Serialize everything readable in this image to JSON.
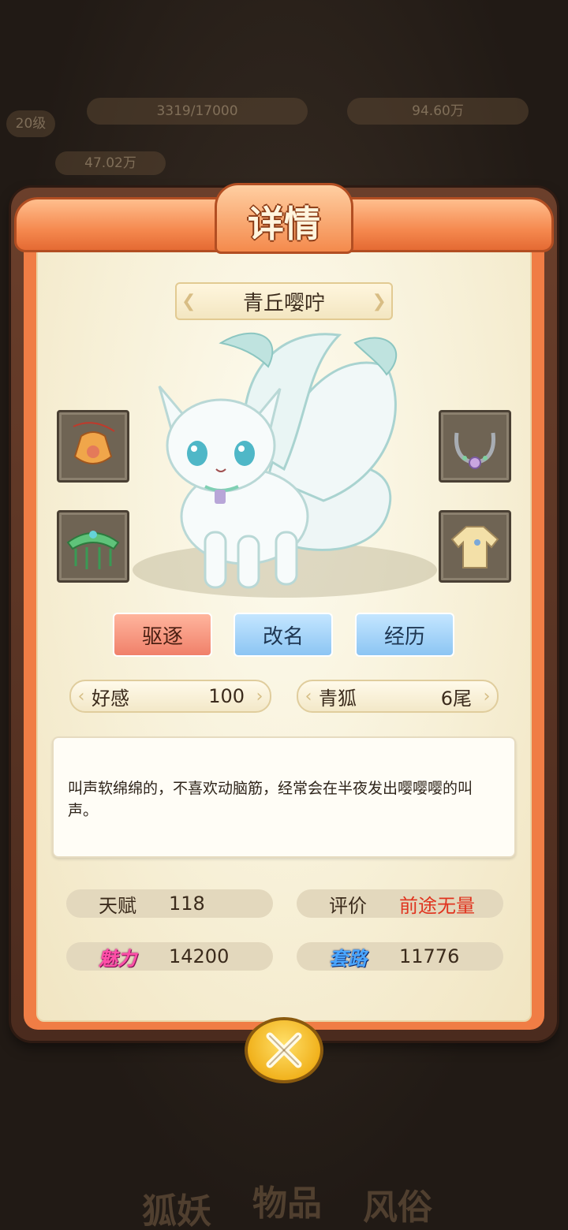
{
  "background": {
    "top_stat_left": "3319/17000",
    "top_stat_right": "94.60万",
    "level_badge": "20级",
    "charm_total": "47.02万",
    "bottom_labels": [
      "狐妖",
      "物品",
      "风俗"
    ]
  },
  "dialog": {
    "title": "详情",
    "pet_name": "青丘嘤咛",
    "buttons": {
      "expel": "驱逐",
      "rename": "改名",
      "history": "经历"
    },
    "affinity": {
      "label": "好感",
      "value": "100"
    },
    "species": {
      "label": "青狐",
      "value": "6尾"
    },
    "description": "叫声软绵绵的，不喜欢动脑筋，经常会在半夜发出嘤嘤嘤的叫声。",
    "stats": {
      "talent": {
        "label": "天赋",
        "value": "118"
      },
      "rating": {
        "label": "评价",
        "value": "前途无量"
      },
      "charm": {
        "label": "魅力",
        "value": "14200"
      },
      "tactics": {
        "label": "套路",
        "value": "11776"
      }
    },
    "equipment": [
      "pouch-icon",
      "necklace-icon",
      "headdress-icon",
      "robe-icon"
    ],
    "colors": {
      "accent": "#f07d45",
      "rating_red": "#e0331e",
      "button_red": "#f0806a",
      "button_blue": "#8cc5f3"
    }
  }
}
